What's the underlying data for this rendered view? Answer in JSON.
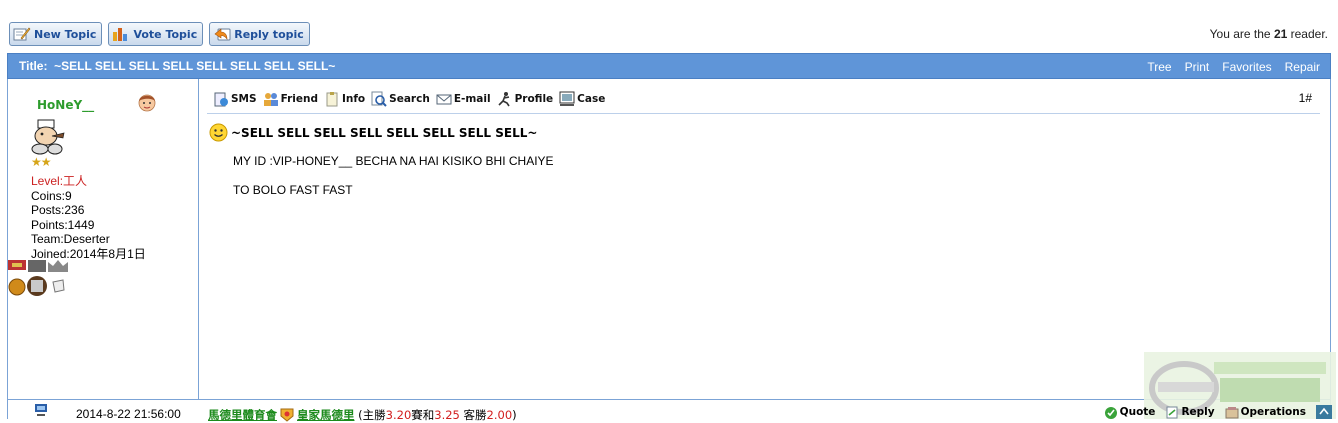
{
  "toolbar": {
    "new_topic": "New Topic",
    "vote_topic": "Vote Topic",
    "reply_topic": "Reply topic"
  },
  "reader": {
    "prefix": "You are the",
    "count": "21",
    "suffix": "reader."
  },
  "titlebar": {
    "label": "Title:",
    "title": "~SELL SELL SELL SELL SELL SELL SELL SELL~",
    "links": [
      "Tree",
      "Print",
      "Favorites",
      "Repair"
    ]
  },
  "user": {
    "name": "HoNeY__",
    "level": "Level:工人",
    "coins": "Coins:9",
    "posts": "Posts:236",
    "points": "Points:1449",
    "team": "Team:Deserter",
    "joined": "Joined:2014年8月1日",
    "stars": "★★"
  },
  "post": {
    "tools": [
      "SMS",
      "Friend",
      "Info",
      "Search",
      "E-mail",
      "Profile",
      "Case"
    ],
    "floor": "1#",
    "title": "~SELL SELL SELL SELL SELL SELL SELL SELL~",
    "lines": [
      "MY ID :VIP-HONEY__ BECHA NA HAI KISIKO BHI CHAIYE",
      "TO BOLO FAST FAST"
    ]
  },
  "footer": {
    "time": "2014-8-22 21:56:00",
    "ad": {
      "link1": "馬德里體育會",
      "link2": "皇家馬德里",
      "open": "(主勝",
      "home": "3.20",
      "draw_label": "賽和",
      "draw": "3.25",
      "away_label": "客勝",
      "away": "2.00",
      "close": ")"
    },
    "actions": {
      "quote": "Quote",
      "reply": "Reply",
      "operations": "Operations"
    }
  },
  "colors": {
    "titlebar_bg": "#5f95d8",
    "border": "#7ba3d6",
    "username": "#2d9c2d",
    "level": "#cc2222",
    "odds": "#d21d1d"
  }
}
